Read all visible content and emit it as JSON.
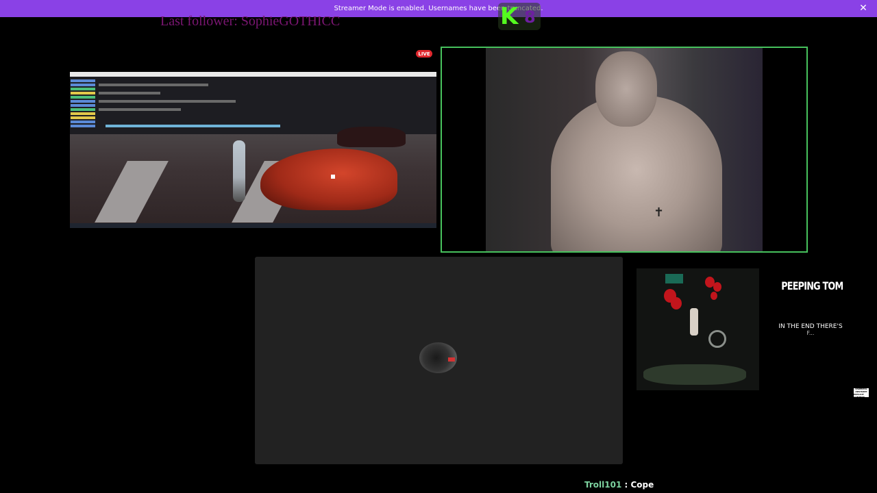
{
  "banner": {
    "text": "Streamer Mode is enabled. Usernames have been truncated.",
    "close_icon": "close-icon",
    "color": "#8a41e6"
  },
  "kick_overlay": {
    "logo_letter": "K",
    "count": "8",
    "logo_color": "#54fc1f"
  },
  "last_follower": {
    "text": "Last follower: SophieGOTHICC"
  },
  "live_badge": {
    "label": "LIVE"
  },
  "now_playing": {
    "title": "PEEPING TOM",
    "lyric_line1": "IN THE END THERE'S",
    "lyric_line2": "F..."
  },
  "explicit_label": {
    "line1": "PARENTAL",
    "line2": "ADVISORY",
    "line3": "EXPLICIT CONTENT"
  },
  "chat": {
    "username": "Troll101",
    "separator": ":",
    "message": "Cope",
    "username_color": "#7dd3a0"
  }
}
